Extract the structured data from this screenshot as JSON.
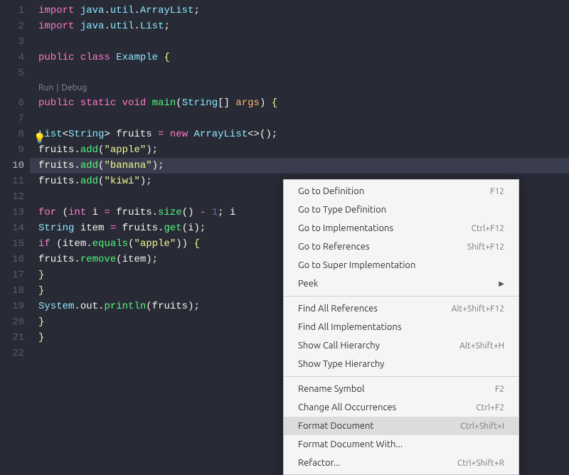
{
  "code": {
    "line1_import": "import",
    "line1_pkg_a": "java",
    "line1_pkg_b": "util",
    "line1_cls": "ArrayList",
    "line2_import": "import",
    "line2_pkg_a": "java",
    "line2_pkg_b": "util",
    "line2_cls": "List",
    "line4_public": "public",
    "line4_class": "class",
    "line4_name": "Example",
    "line4_brace": "{",
    "codelens_run": "Run",
    "codelens_sep": "|",
    "codelens_debug": "Debug",
    "line6_public": "public",
    "line6_static": "static",
    "line6_void": "void",
    "line6_main": "main",
    "line6_paren_o": "(",
    "line6_String": "String",
    "line6_brackets": "[]",
    "line6_args": "args",
    "line6_paren_c": ")",
    "line6_brace": "{",
    "line8_List": "List",
    "line8_lt": "<",
    "line8_String": "String",
    "line8_gt": ">",
    "line8_var": "fruits",
    "line8_eq": "=",
    "line8_new": "new",
    "line8_ArrayList": "ArrayList",
    "line8_diamond": "<>();",
    "line9_var": "fruits",
    "line9_dot": ".",
    "line9_add": "add",
    "line9_po": "(",
    "line9_str": "\"apple\"",
    "line9_pc": ");",
    "line10_var": "fruits",
    "line10_add": "add",
    "line10_str": "\"banana\"",
    "line11_var": "fruits",
    "line11_add": "add",
    "line11_str": "\"kiwi\"",
    "line13_for": "for",
    "line13_po": "(",
    "line13_int": "int",
    "line13_i": "i",
    "line13_eq": "=",
    "line13_fruits": "fruits",
    "line13_size": "size",
    "line13_pc1": "()",
    "line13_minus": "-",
    "line13_one": "1",
    "line13_semi": ";",
    "line13_i2": "i",
    "line14_String": "String",
    "line14_item": "item",
    "line14_eq": "=",
    "line14_fruits": "fruits",
    "line14_get": "get",
    "line14_po": "(",
    "line14_i": "i",
    "line14_pc": ");",
    "line15_if": "if",
    "line15_po": "(",
    "line15_item": "item",
    "line15_equals": "equals",
    "line15_po2": "(",
    "line15_str": "\"apple\"",
    "line15_pc": "))",
    "line15_brace": "{",
    "line16_fruits": "fruits",
    "line16_remove": "remove",
    "line16_po": "(",
    "line16_item": "item",
    "line16_pc": ");",
    "line17_brace": "}",
    "line18_brace": "}",
    "line19_System": "System",
    "line19_out": "out",
    "line19_println": "println",
    "line19_po": "(",
    "line19_fruits": "fruits",
    "line19_pc": ");",
    "line20_brace": "}",
    "line21_brace": "}"
  },
  "lineNumbers": [
    "1",
    "2",
    "3",
    "4",
    "5",
    "6",
    "7",
    "8",
    "9",
    "10",
    "11",
    "12",
    "13",
    "14",
    "15",
    "16",
    "17",
    "18",
    "19",
    "20",
    "21",
    "22"
  ],
  "activeLine": "10",
  "lightbulb": "💡",
  "menu": {
    "items": [
      {
        "label": "Go to Definition",
        "kb": "F12"
      },
      {
        "label": "Go to Type Definition",
        "kb": ""
      },
      {
        "label": "Go to Implementations",
        "kb": "Ctrl+F12"
      },
      {
        "label": "Go to References",
        "kb": "Shift+F12"
      },
      {
        "label": "Go to Super Implementation",
        "kb": ""
      },
      {
        "label": "Peek",
        "kb": "",
        "submenu": true
      },
      {
        "sep": true
      },
      {
        "label": "Find All References",
        "kb": "Alt+Shift+F12"
      },
      {
        "label": "Find All Implementations",
        "kb": ""
      },
      {
        "label": "Show Call Hierarchy",
        "kb": "Alt+Shift+H"
      },
      {
        "label": "Show Type Hierarchy",
        "kb": ""
      },
      {
        "sep": true
      },
      {
        "label": "Rename Symbol",
        "kb": "F2"
      },
      {
        "label": "Change All Occurrences",
        "kb": "Ctrl+F2"
      },
      {
        "label": "Format Document",
        "kb": "Ctrl+Shift+I",
        "hover": true
      },
      {
        "label": "Format Document With...",
        "kb": ""
      },
      {
        "label": "Refactor...",
        "kb": "Ctrl+Shift+R"
      }
    ]
  }
}
